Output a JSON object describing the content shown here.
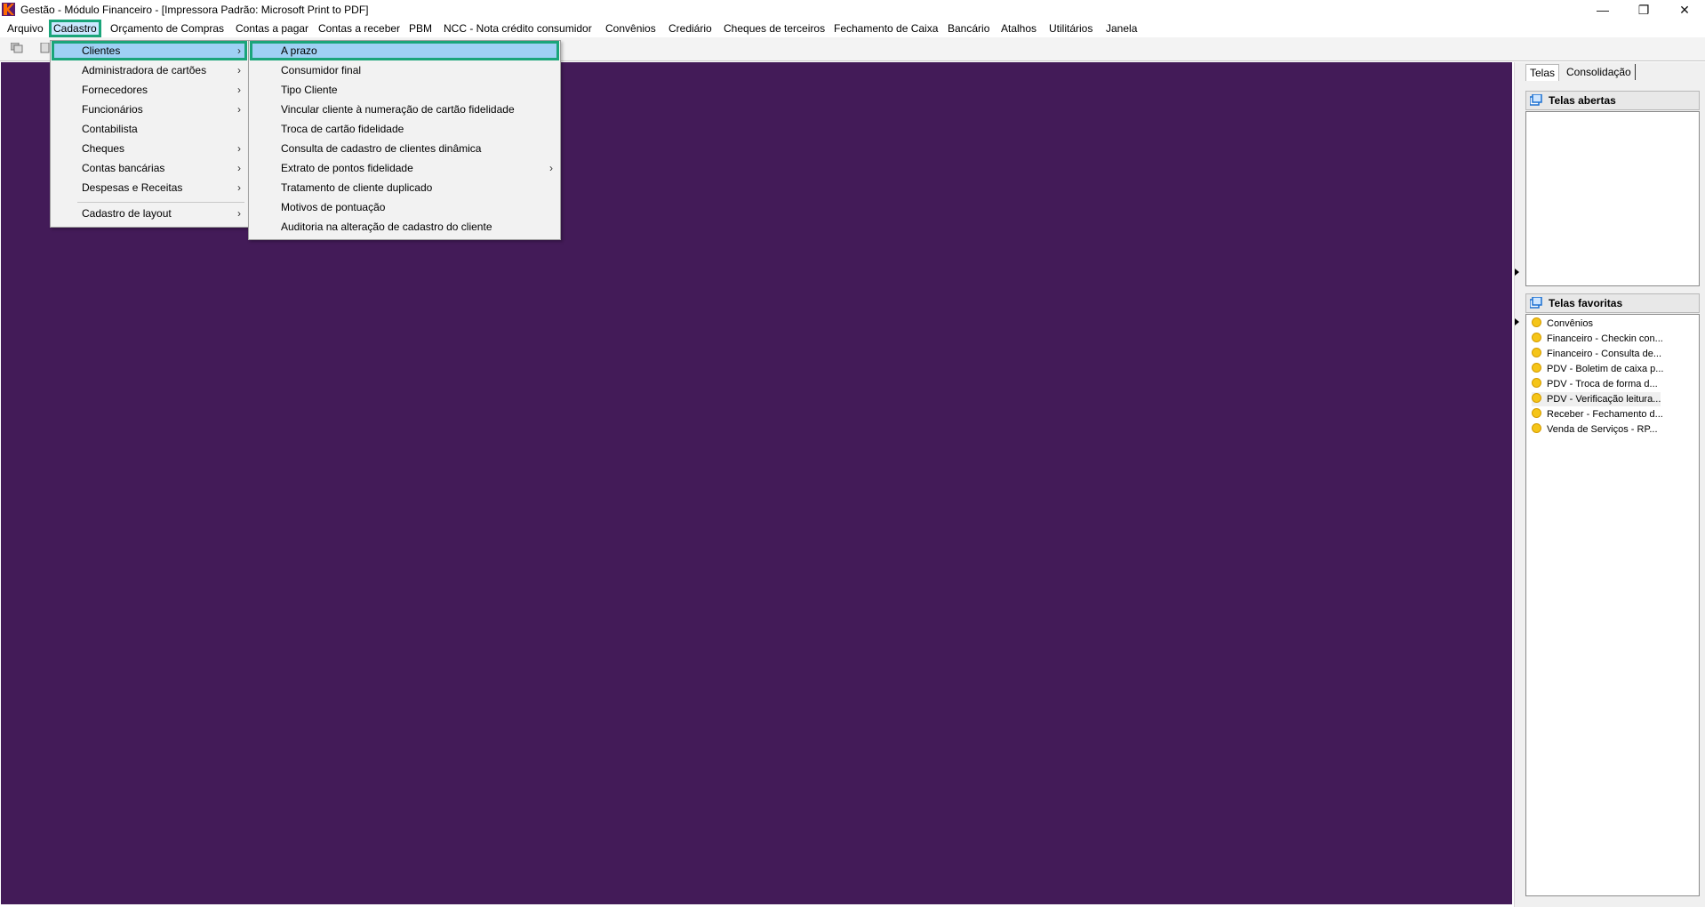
{
  "window": {
    "title": "Gestão  - Módulo Financeiro - [Impressora Padrão: Microsoft Print to PDF]",
    "controls": {
      "minimize": "—",
      "restore": "❐",
      "close": "✕"
    }
  },
  "menubar": {
    "items": [
      "Arquivo",
      "Cadastro",
      "Orçamento de Compras",
      "Contas a pagar",
      "Contas a receber",
      "PBM",
      "NCC - Nota crédito consumidor",
      "Convênios",
      "Crediário",
      "Cheques de terceiros",
      "Fechamento de Caixa",
      "Bancário",
      "Atalhos",
      "Utilitários",
      "Janela"
    ],
    "active": "Cadastro"
  },
  "cadastro_menu": {
    "items": [
      {
        "label": "Clientes",
        "submenu": true,
        "selected": true
      },
      {
        "label": "Administradora de cartões",
        "submenu": true
      },
      {
        "label": "Fornecedores",
        "submenu": true
      },
      {
        "label": "Funcionários",
        "submenu": true
      },
      {
        "label": "Contabilista",
        "submenu": false
      },
      {
        "label": "Cheques",
        "submenu": true
      },
      {
        "label": "Contas bancárias",
        "submenu": true
      },
      {
        "label": "Despesas e Receitas",
        "submenu": true
      },
      {
        "label": "Cadastro de layout",
        "submenu": true
      }
    ],
    "arrow": "›"
  },
  "clientes_menu": {
    "items": [
      {
        "label": "A prazo",
        "selected": true
      },
      {
        "label": "Consumidor final"
      },
      {
        "label": "Tipo Cliente"
      },
      {
        "label": "Vincular cliente à numeração de cartão fidelidade"
      },
      {
        "label": "Troca de cartão fidelidade"
      },
      {
        "label": "Consulta de cadastro de clientes dinâmica"
      },
      {
        "label": "Extrato de pontos fidelidade",
        "submenu": true
      },
      {
        "label": "Tratamento de cliente duplicado"
      },
      {
        "label": "Motivos de pontuação"
      },
      {
        "label": "Auditoria na alteração de cadastro do cliente"
      }
    ]
  },
  "right_panel": {
    "tabs": [
      "Telas",
      "Consolidação"
    ],
    "open_screens": {
      "title": "Telas abertas"
    },
    "favorites": {
      "title": "Telas favoritas",
      "items": [
        "Convênios",
        "Financeiro - Checkin con...",
        "Financeiro - Consulta de...",
        "PDV - Boletim de caixa p...",
        "PDV - Troca de forma d...",
        "PDV - Verificação leitura...",
        "Receber - Fechamento d...",
        "Venda de Serviços - RP..."
      ]
    }
  },
  "colors": {
    "workspace": "#431b58",
    "highlight_border": "#1aa57a",
    "selection": "#9fd0f4"
  }
}
